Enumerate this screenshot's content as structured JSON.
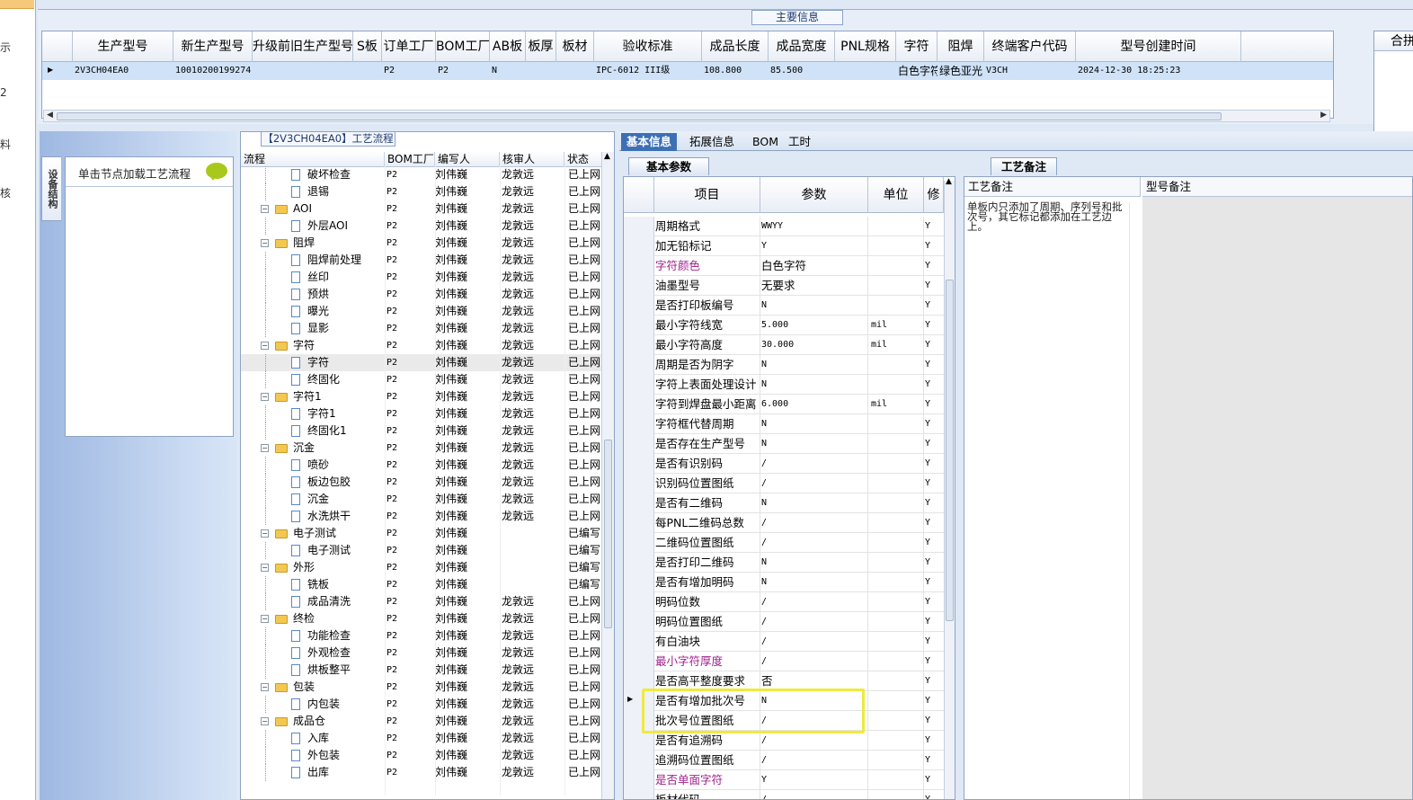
{
  "leftnav": [
    "示",
    "2",
    "料",
    "核"
  ],
  "main_info": {
    "legend": "主要信息",
    "columns": [
      "生产型号",
      "新生产型号",
      "升级前旧生产型号",
      "S板",
      "订单工厂",
      "BOM工厂",
      "AB板",
      "板厚",
      "板材",
      "验收标准",
      "成品长度",
      "成品宽度",
      "PNL规格",
      "字符",
      "阻焊",
      "终端客户代码",
      "型号创建时间"
    ],
    "row": {
      "生产型号": "2V3CH04EA0",
      "新生产型号": "10010200199274",
      "订单工厂": "P2",
      "BOM工厂": "P2",
      "AB板": "N",
      "验收标准": "IPC-6012 III级",
      "成品长度": "108.800",
      "成品宽度": "85.500",
      "字符": "白色字符",
      "阻焊": "绿色亚光",
      "终端客户代码": "V3CH",
      "型号创建时间": "2024-12-30 18:25:23"
    },
    "merge_header": "合拼型号"
  },
  "left_panel": {
    "tab": "设备结构",
    "prompt": "单击节点加载工艺流程"
  },
  "process_tree": {
    "legend": "【2V3CH04EA0】工艺流程",
    "headers": [
      "流程",
      "BOM工厂",
      "编写人",
      "核审人",
      "状态"
    ],
    "rows": [
      {
        "level": 1,
        "type": "doc",
        "name": "破坏检查",
        "bom": "P2",
        "writer": "刘伟巍",
        "reviewer": "龙敦远",
        "status": "已上网"
      },
      {
        "level": 1,
        "type": "doc",
        "name": "退锡",
        "bom": "P2",
        "writer": "刘伟巍",
        "reviewer": "龙敦远",
        "status": "已上网"
      },
      {
        "level": 0,
        "type": "folder",
        "name": "AOI",
        "bom": "P2",
        "writer": "刘伟巍",
        "reviewer": "龙敦远",
        "status": "已上网"
      },
      {
        "level": 1,
        "type": "doc",
        "name": "外层AOI",
        "bom": "P2",
        "writer": "刘伟巍",
        "reviewer": "龙敦远",
        "status": "已上网"
      },
      {
        "level": 0,
        "type": "folder",
        "name": "阻焊",
        "bom": "P2",
        "writer": "刘伟巍",
        "reviewer": "龙敦远",
        "status": "已上网"
      },
      {
        "level": 1,
        "type": "doc",
        "name": "阻焊前处理",
        "bom": "P2",
        "writer": "刘伟巍",
        "reviewer": "龙敦远",
        "status": "已上网"
      },
      {
        "level": 1,
        "type": "doc",
        "name": "丝印",
        "bom": "P2",
        "writer": "刘伟巍",
        "reviewer": "龙敦远",
        "status": "已上网"
      },
      {
        "level": 1,
        "type": "doc",
        "name": "预烘",
        "bom": "P2",
        "writer": "刘伟巍",
        "reviewer": "龙敦远",
        "status": "已上网"
      },
      {
        "level": 1,
        "type": "doc",
        "name": "曝光",
        "bom": "P2",
        "writer": "刘伟巍",
        "reviewer": "龙敦远",
        "status": "已上网"
      },
      {
        "level": 1,
        "type": "doc",
        "name": "显影",
        "bom": "P2",
        "writer": "刘伟巍",
        "reviewer": "龙敦远",
        "status": "已上网"
      },
      {
        "level": 0,
        "type": "folder",
        "name": "字符",
        "bom": "P2",
        "writer": "刘伟巍",
        "reviewer": "龙敦远",
        "status": "已上网"
      },
      {
        "level": 1,
        "type": "doc",
        "name": "字符",
        "bom": "P2",
        "writer": "刘伟巍",
        "reviewer": "龙敦远",
        "status": "已上网",
        "selected": true
      },
      {
        "level": 1,
        "type": "doc",
        "name": "终固化",
        "bom": "P2",
        "writer": "刘伟巍",
        "reviewer": "龙敦远",
        "status": "已上网"
      },
      {
        "level": 0,
        "type": "folder",
        "name": "字符1",
        "bom": "P2",
        "writer": "刘伟巍",
        "reviewer": "龙敦远",
        "status": "已上网"
      },
      {
        "level": 1,
        "type": "doc",
        "name": "字符1",
        "bom": "P2",
        "writer": "刘伟巍",
        "reviewer": "龙敦远",
        "status": "已上网"
      },
      {
        "level": 1,
        "type": "doc",
        "name": "终固化1",
        "bom": "P2",
        "writer": "刘伟巍",
        "reviewer": "龙敦远",
        "status": "已上网"
      },
      {
        "level": 0,
        "type": "folder",
        "name": "沉金",
        "bom": "P2",
        "writer": "刘伟巍",
        "reviewer": "龙敦远",
        "status": "已上网"
      },
      {
        "level": 1,
        "type": "doc",
        "name": "喷砂",
        "bom": "P2",
        "writer": "刘伟巍",
        "reviewer": "龙敦远",
        "status": "已上网"
      },
      {
        "level": 1,
        "type": "doc",
        "name": "板边包胶",
        "bom": "P2",
        "writer": "刘伟巍",
        "reviewer": "龙敦远",
        "status": "已上网"
      },
      {
        "level": 1,
        "type": "doc",
        "name": "沉金",
        "bom": "P2",
        "writer": "刘伟巍",
        "reviewer": "龙敦远",
        "status": "已上网"
      },
      {
        "level": 1,
        "type": "doc",
        "name": "水洗烘干",
        "bom": "P2",
        "writer": "刘伟巍",
        "reviewer": "龙敦远",
        "status": "已上网"
      },
      {
        "level": 0,
        "type": "folder",
        "name": "电子测试",
        "bom": "P2",
        "writer": "刘伟巍",
        "reviewer": "",
        "status": "已编写"
      },
      {
        "level": 1,
        "type": "doc",
        "name": "电子测试",
        "bom": "P2",
        "writer": "刘伟巍",
        "reviewer": "",
        "status": "已编写"
      },
      {
        "level": 0,
        "type": "folder",
        "name": "外形",
        "bom": "P2",
        "writer": "刘伟巍",
        "reviewer": "",
        "status": "已编写"
      },
      {
        "level": 1,
        "type": "doc",
        "name": "铣板",
        "bom": "P2",
        "writer": "刘伟巍",
        "reviewer": "",
        "status": "已编写"
      },
      {
        "level": 1,
        "type": "doc",
        "name": "成品清洗",
        "bom": "P2",
        "writer": "刘伟巍",
        "reviewer": "龙敦远",
        "status": "已上网"
      },
      {
        "level": 0,
        "type": "folder",
        "name": "终检",
        "bom": "P2",
        "writer": "刘伟巍",
        "reviewer": "龙敦远",
        "status": "已上网"
      },
      {
        "level": 1,
        "type": "doc",
        "name": "功能检查",
        "bom": "P2",
        "writer": "刘伟巍",
        "reviewer": "龙敦远",
        "status": "已上网"
      },
      {
        "level": 1,
        "type": "doc",
        "name": "外观检查",
        "bom": "P2",
        "writer": "刘伟巍",
        "reviewer": "龙敦远",
        "status": "已上网"
      },
      {
        "level": 1,
        "type": "doc",
        "name": "烘板整平",
        "bom": "P2",
        "writer": "刘伟巍",
        "reviewer": "龙敦远",
        "status": "已上网"
      },
      {
        "level": 0,
        "type": "folder",
        "name": "包装",
        "bom": "P2",
        "writer": "刘伟巍",
        "reviewer": "龙敦远",
        "status": "已上网"
      },
      {
        "level": 1,
        "type": "doc",
        "name": "内包装",
        "bom": "P2",
        "writer": "刘伟巍",
        "reviewer": "龙敦远",
        "status": "已上网"
      },
      {
        "level": 0,
        "type": "folder",
        "name": "成品仓",
        "bom": "P2",
        "writer": "刘伟巍",
        "reviewer": "龙敦远",
        "status": "已上网"
      },
      {
        "level": 1,
        "type": "doc",
        "name": "入库",
        "bom": "P2",
        "writer": "刘伟巍",
        "reviewer": "龙敦远",
        "status": "已上网"
      },
      {
        "level": 1,
        "type": "doc",
        "name": "外包装",
        "bom": "P2",
        "writer": "刘伟巍",
        "reviewer": "龙敦远",
        "status": "已上网"
      },
      {
        "level": 1,
        "type": "doc",
        "name": "出库",
        "bom": "P2",
        "writer": "刘伟巍",
        "reviewer": "龙敦远",
        "status": "已上网"
      }
    ]
  },
  "tabs": [
    "基本信息",
    "拓展信息",
    "BOM",
    "工时"
  ],
  "basic_params": {
    "subtab": "基本参数",
    "headers": [
      "项目",
      "参数",
      "单位",
      "修"
    ],
    "rows": [
      {
        "item": "周期格式",
        "value": "WWYY",
        "unit": "",
        "flag": "Y"
      },
      {
        "item": "加无铅标记",
        "value": "Y",
        "unit": "",
        "flag": "Y"
      },
      {
        "item": "字符颜色",
        "value": "白色字符",
        "unit": "",
        "flag": "Y",
        "purple": true
      },
      {
        "item": "油墨型号",
        "value": "无要求",
        "unit": "",
        "flag": "Y"
      },
      {
        "item": "是否打印板编号",
        "value": "N",
        "unit": "",
        "flag": "Y"
      },
      {
        "item": "最小字符线宽",
        "value": "5.000",
        "unit": "mil",
        "flag": "Y"
      },
      {
        "item": "最小字符高度",
        "value": "30.000",
        "unit": "mil",
        "flag": "Y"
      },
      {
        "item": "周期是否为阴字",
        "value": "N",
        "unit": "",
        "flag": "Y"
      },
      {
        "item": "字符上表面处理设计",
        "value": "N",
        "unit": "",
        "flag": "Y"
      },
      {
        "item": "字符到焊盘最小距离",
        "value": "6.000",
        "unit": "mil",
        "flag": "Y"
      },
      {
        "item": "字符框代替周期",
        "value": "N",
        "unit": "",
        "flag": "Y"
      },
      {
        "item": "是否存在生产型号",
        "value": "N",
        "unit": "",
        "flag": "Y"
      },
      {
        "item": "是否有识别码",
        "value": "/",
        "unit": "",
        "flag": "Y"
      },
      {
        "item": "识别码位置图纸",
        "value": "/",
        "unit": "",
        "flag": "Y"
      },
      {
        "item": "是否有二维码",
        "value": "N",
        "unit": "",
        "flag": "Y"
      },
      {
        "item": "每PNL二维码总数",
        "value": "/",
        "unit": "",
        "flag": "Y"
      },
      {
        "item": "二维码位置图纸",
        "value": "/",
        "unit": "",
        "flag": "Y"
      },
      {
        "item": "是否打印二维码",
        "value": "N",
        "unit": "",
        "flag": "Y"
      },
      {
        "item": "是否有增加明码",
        "value": "N",
        "unit": "",
        "flag": "Y"
      },
      {
        "item": "明码位数",
        "value": "/",
        "unit": "",
        "flag": "Y"
      },
      {
        "item": "明码位置图纸",
        "value": "/",
        "unit": "",
        "flag": "Y"
      },
      {
        "item": "有白油块",
        "value": "/",
        "unit": "",
        "flag": "Y"
      },
      {
        "item": "最小字符厚度",
        "value": "/",
        "unit": "",
        "flag": "Y",
        "purple": true
      },
      {
        "item": "是否高平整度要求",
        "value": "否",
        "unit": "",
        "flag": "Y"
      },
      {
        "item": "是否有增加批次号",
        "value": "N",
        "unit": "",
        "flag": "Y",
        "current": true
      },
      {
        "item": "批次号位置图纸",
        "value": "/",
        "unit": "",
        "flag": "Y"
      },
      {
        "item": "是否有追溯码",
        "value": "/",
        "unit": "",
        "flag": "Y"
      },
      {
        "item": "追溯码位置图纸",
        "value": "/",
        "unit": "",
        "flag": "Y"
      },
      {
        "item": "是否单面字符",
        "value": "Y",
        "unit": "",
        "flag": "Y",
        "purple": true
      },
      {
        "item": "板材代码",
        "value": "/",
        "unit": "",
        "flag": "Y"
      }
    ]
  },
  "process_notes": {
    "tab": "工艺备注",
    "col1": "工艺备注",
    "col2": "型号备注",
    "text": "单板内只添加了周期、序列号和批次号，其它标记都添加在工艺边上。"
  }
}
